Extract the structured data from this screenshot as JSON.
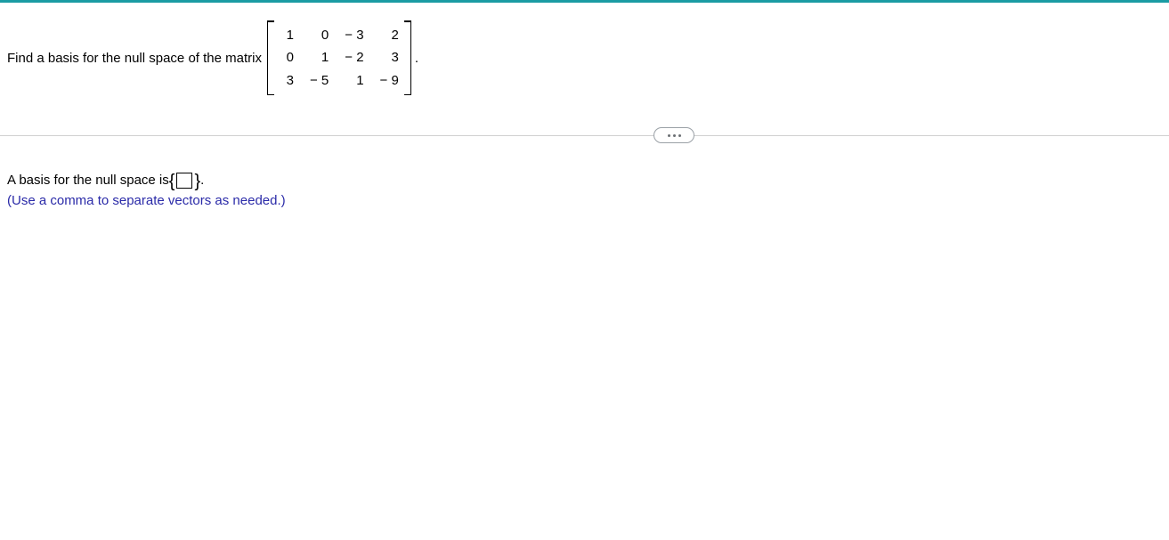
{
  "question": {
    "prompt_text": "Find a basis for the null space of the matrix",
    "matrix": {
      "rows": 3,
      "cols": 4,
      "values": [
        [
          "1",
          "0",
          "− 3",
          "2"
        ],
        [
          "0",
          "1",
          "− 2",
          "3"
        ],
        [
          "3",
          "− 5",
          "1",
          "− 9"
        ]
      ]
    },
    "period": "."
  },
  "answer": {
    "lead_text": "A basis for the null space is ",
    "left_brace": "{",
    "right_brace": "}",
    "trailing_period": ".",
    "input_value": "",
    "hint": "(Use a comma to separate vectors as needed.)"
  },
  "controls": {
    "more_label": "more-options"
  }
}
